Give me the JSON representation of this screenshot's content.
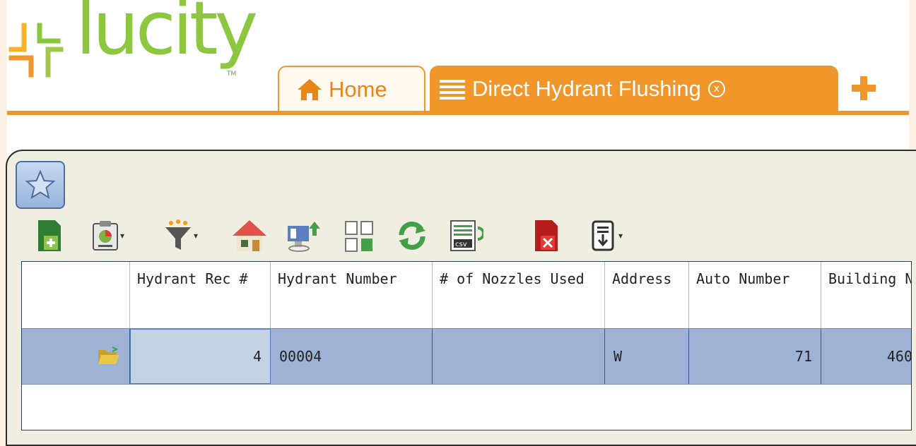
{
  "brand": {
    "name": "lucity",
    "trademark": "TM",
    "color": "#8dc63f"
  },
  "tabs": {
    "home_label": "Home",
    "active_label": "Direct Hydrant Flushing",
    "close_label": "x"
  },
  "colors": {
    "accent": "#f0962a",
    "grid_row": "#9db2d4",
    "grid_selected_cell": "#c5d2e5"
  },
  "toolbar": {
    "buttons": [
      "favorite-star-icon",
      "new-record-icon",
      "report-icon",
      "filter-icon",
      "home-icon",
      "monitor-upload-icon",
      "copy-pages-icon",
      "refresh-icon",
      "csv-export-icon",
      "delete-record-icon",
      "export-download-icon"
    ]
  },
  "grid": {
    "columns": [
      "Hydrant Rec #",
      "Hydrant Number",
      "# of Nozzles Used",
      "Address",
      "Auto Number",
      "Building N"
    ],
    "rows": [
      {
        "rec": "4",
        "number": "00004",
        "nozzles": "",
        "address": "W",
        "auto": "71",
        "building": "460"
      }
    ]
  }
}
